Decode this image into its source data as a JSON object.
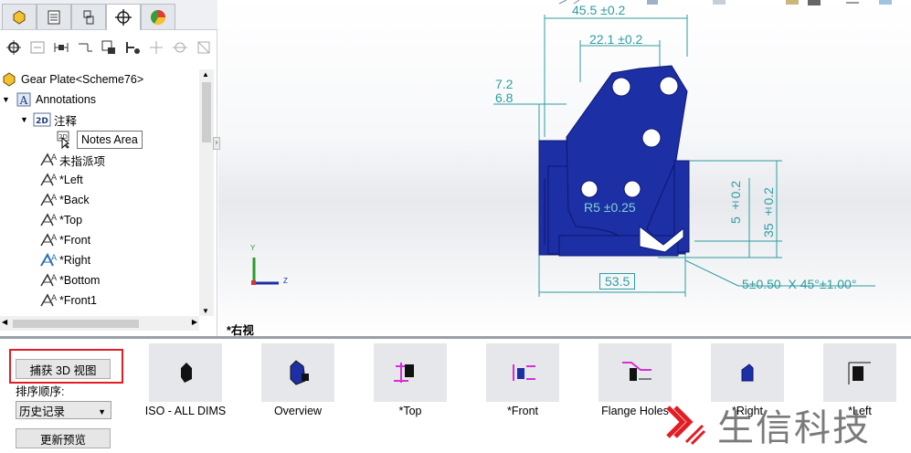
{
  "panel": {
    "tree": {
      "root": "Gear Plate<Scheme76>",
      "annotations": "Annotations",
      "notes_folder": "注释",
      "notes_area": "Notes Area",
      "unassigned": "未指派项",
      "views": [
        "*Left",
        "*Back",
        "*Top",
        "*Front",
        "*Right",
        "*Bottom",
        "*Front1"
      ]
    },
    "tooltip": "Notes Area"
  },
  "viewport": {
    "view_name": "*右视",
    "dims": {
      "d1": "45.5 ±0.2",
      "d2": "22.1 ±0.2",
      "d3a": "7.2",
      "d3b": "6.8",
      "d4": "R5 ±0.25",
      "d5": "5 ±0.2",
      "d6": "35 ±0.2",
      "d7": "53.5",
      "d8": "5±0.50  X 45°±1.00°"
    },
    "triad": {
      "y": "Y",
      "z": "Z"
    },
    "colors": {
      "part": "#1c2fa5",
      "dimension": "#2e9da0"
    }
  },
  "bottom": {
    "capture_button": "捕获 3D 视图",
    "sort_label": "排序顺序:",
    "sort_value": "历史记录",
    "refresh_button": "更新预览",
    "views": [
      "ISO - ALL DIMS",
      "Overview",
      "*Top",
      "*Front",
      "Flange Holes",
      "*Right",
      "*Left"
    ]
  },
  "watermark": {
    "text": "生信科技"
  }
}
